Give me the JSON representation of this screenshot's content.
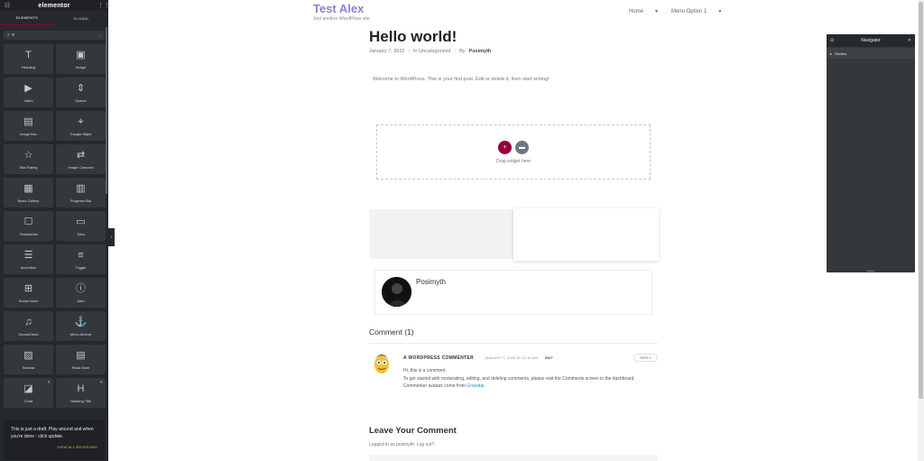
{
  "panel": {
    "brand": "elementor",
    "tabs": [
      "ELEMENTS",
      "GLOBAL"
    ],
    "search_value": "e",
    "widgets": [
      {
        "label": "Heading",
        "icon": "heading-icon",
        "glyph": "T",
        "pro": false
      },
      {
        "label": "Image",
        "icon": "image-icon",
        "glyph": "▣",
        "pro": false
      },
      {
        "label": "Video",
        "icon": "video-icon",
        "glyph": "▶",
        "pro": false
      },
      {
        "label": "Spacer",
        "icon": "spacer-icon",
        "glyph": "⇕",
        "pro": false
      },
      {
        "label": "Image Box",
        "icon": "image-box-icon",
        "glyph": "▤",
        "pro": false
      },
      {
        "label": "Google Maps",
        "icon": "map-icon",
        "glyph": "⌖",
        "pro": false
      },
      {
        "label": "Star Rating",
        "icon": "star-rating-icon",
        "glyph": "☆",
        "pro": false
      },
      {
        "label": "Image Carousel",
        "icon": "carousel-icon",
        "glyph": "⇄",
        "pro": false
      },
      {
        "label": "Basic Gallery",
        "icon": "gallery-icon",
        "glyph": "▦",
        "pro": false
      },
      {
        "label": "Progress Bar",
        "icon": "progress-bar-icon",
        "glyph": "▥",
        "pro": false
      },
      {
        "label": "Testimonial",
        "icon": "testimonial-icon",
        "glyph": "☐",
        "pro": false
      },
      {
        "label": "Tabs",
        "icon": "tabs-icon",
        "glyph": "▭",
        "pro": false
      },
      {
        "label": "Accordion",
        "icon": "accordion-icon",
        "glyph": "☰",
        "pro": false
      },
      {
        "label": "Toggle",
        "icon": "toggle-icon",
        "glyph": "≡",
        "pro": false
      },
      {
        "label": "Social Icons",
        "icon": "social-icons-icon",
        "glyph": "⊞",
        "pro": false
      },
      {
        "label": "Alert",
        "icon": "alert-icon",
        "glyph": "ⓘ",
        "pro": false
      },
      {
        "label": "SoundCloud",
        "icon": "soundcloud-icon",
        "glyph": "♫",
        "pro": false
      },
      {
        "label": "Menu Anchor",
        "icon": "anchor-icon",
        "glyph": "⚓",
        "pro": false
      },
      {
        "label": "Sidebar",
        "icon": "sidebar-icon",
        "glyph": "▨",
        "pro": false
      },
      {
        "label": "Read More",
        "icon": "read-more-icon",
        "glyph": "▤",
        "pro": false
      },
      {
        "label": "Chart",
        "icon": "chart-icon",
        "glyph": "◪",
        "pro": true
      },
      {
        "label": "Heading Title",
        "icon": "heading-title-icon",
        "glyph": "H",
        "pro": true
      }
    ]
  },
  "toast": {
    "message": "This is just a draft. Play around and when you're done - click update.",
    "link": "VIEW ALL REVISIONS"
  },
  "site": {
    "title": "Test Alex",
    "tagline": "Just another WordPress site",
    "nav": [
      "Home",
      "Menu Option 1"
    ]
  },
  "post": {
    "title": "Hello world!",
    "date": "January 7, 2022",
    "category": "In Uncategorized",
    "by_prefix": "By",
    "author": "Posimyth",
    "body": "Welcome to WordPress. This is your first post. Edit or delete it, then start writing!",
    "dropzone_text": "Drag widget here"
  },
  "author_box": {
    "name": "Posimyth"
  },
  "comments": {
    "title": "Comment (1)",
    "author": "A WORDPRESS COMMENTER",
    "date": "JANUARY 7, 2022 AT 11:16 AM",
    "edit": "EDIT",
    "reply": "REPLY",
    "lines": [
      "Hi, this is a comment.",
      "To get started with moderating, editing, and deleting comments, please visit the Comments screen in the dashboard.",
      "Commenter avatars come from"
    ],
    "gravatar": "Gravatar",
    "gravatar_end": "."
  },
  "leave": {
    "title": "Leave Your Comment",
    "logged_in": "Logged in as posimyth.",
    "logout": "Log out?"
  },
  "navigator": {
    "title": "Navigator",
    "items": [
      "Section"
    ]
  },
  "colors": {
    "panel_bg": "#26292c",
    "accent": "#93003c",
    "site_title": "#8e7fd9",
    "toast_link": "#f0b64e"
  }
}
